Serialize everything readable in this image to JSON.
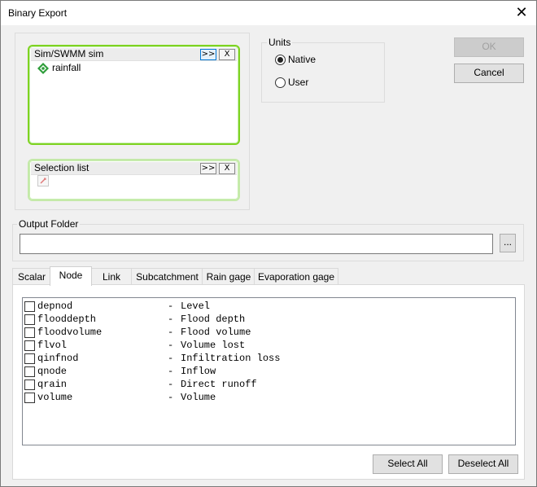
{
  "window": {
    "title": "Binary Export",
    "close_symbol": "✕"
  },
  "sims": {
    "header": "Sim/SWMM sim",
    "add_label": ">>",
    "remove_label": "X",
    "items": [
      {
        "label": "rainfall",
        "icon": "swmm-sim-icon"
      }
    ]
  },
  "selection": {
    "header": "Selection list",
    "add_label": ">>",
    "remove_label": "X"
  },
  "units": {
    "title": "Units",
    "options": [
      {
        "label": "Native",
        "selected": true
      },
      {
        "label": "User",
        "selected": false
      }
    ]
  },
  "buttons": {
    "ok": "OK",
    "cancel": "Cancel",
    "browse": "...",
    "select_all": "Select All",
    "deselect_all": "Deselect All"
  },
  "output_folder": {
    "title": "Output Folder",
    "value": ""
  },
  "tabs": [
    {
      "label": "Scalar",
      "active": false
    },
    {
      "label": "Node",
      "active": true
    },
    {
      "label": "Link",
      "active": false
    },
    {
      "label": "Subcatchment",
      "active": false
    },
    {
      "label": "Rain gage",
      "active": false
    },
    {
      "label": "Evaporation gage",
      "active": false
    }
  ],
  "fields": [
    {
      "name": "depnod",
      "sep": "-",
      "desc": "Level"
    },
    {
      "name": "flooddepth",
      "sep": "-",
      "desc": "Flood depth"
    },
    {
      "name": "floodvolume",
      "sep": "-",
      "desc": "Flood volume"
    },
    {
      "name": "flvol",
      "sep": "-",
      "desc": "Volume lost"
    },
    {
      "name": "qinfnod",
      "sep": "-",
      "desc": "Infiltration loss"
    },
    {
      "name": "qnode",
      "sep": "-",
      "desc": "Inflow"
    },
    {
      "name": "qrain",
      "sep": "-",
      "desc": "Direct runoff"
    },
    {
      "name": "volume",
      "sep": "-",
      "desc": "Volume"
    }
  ]
}
